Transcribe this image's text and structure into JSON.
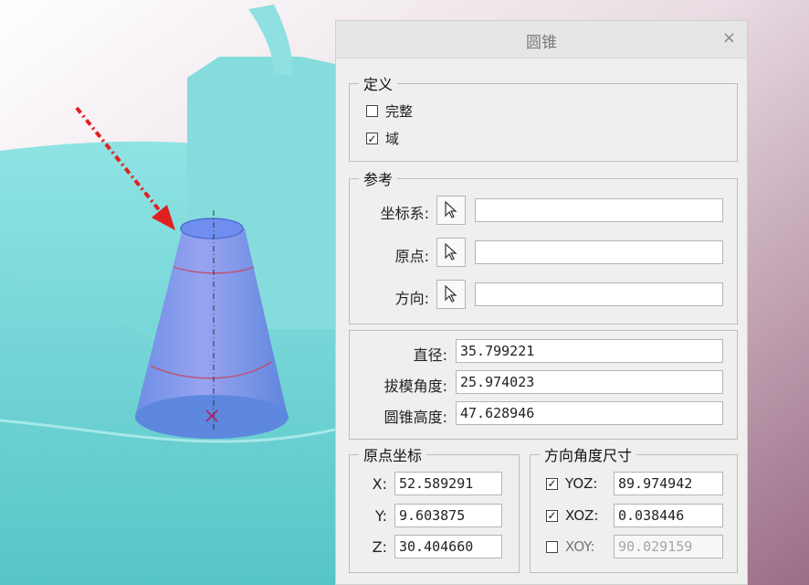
{
  "dialog": {
    "title": "圆锥",
    "close_symbol": "×",
    "definition": {
      "legend": "定义",
      "complete": {
        "label": "完整",
        "checked": false
      },
      "domain": {
        "label": "域",
        "checked": true
      }
    },
    "reference": {
      "legend": "参考",
      "coord_system_label": "坐标系:",
      "origin_label": "原点:",
      "direction_label": "方向:",
      "coord_system_value": "",
      "origin_value": "",
      "direction_value": ""
    },
    "dimensions": {
      "diameter_label": "直径:",
      "diameter_value": "35.799221",
      "draft_angle_label": "拔模角度:",
      "draft_angle_value": "25.974023",
      "cone_height_label": "圆锥高度:",
      "cone_height_value": "47.628946"
    },
    "origin_coords": {
      "legend": "原点坐标",
      "x_label": "X:",
      "x_value": "52.589291",
      "y_label": "Y:",
      "y_value": "9.603875",
      "z_label": "Z:",
      "z_value": "30.404660"
    },
    "direction_angles": {
      "legend": "方向角度尺寸",
      "yoz": {
        "label": "YOZ:",
        "value": "89.974942",
        "checked": true
      },
      "xoz": {
        "label": "XOZ:",
        "value": "0.038446",
        "checked": true
      },
      "xoy": {
        "label": "XOY:",
        "value": "90.029159",
        "checked": false
      }
    }
  },
  "colors": {
    "dialog_bg": "#efefef",
    "model_teal": "#6fd3d3",
    "cone_blue": "#7f95e8",
    "arrow_red": "#e02020"
  }
}
